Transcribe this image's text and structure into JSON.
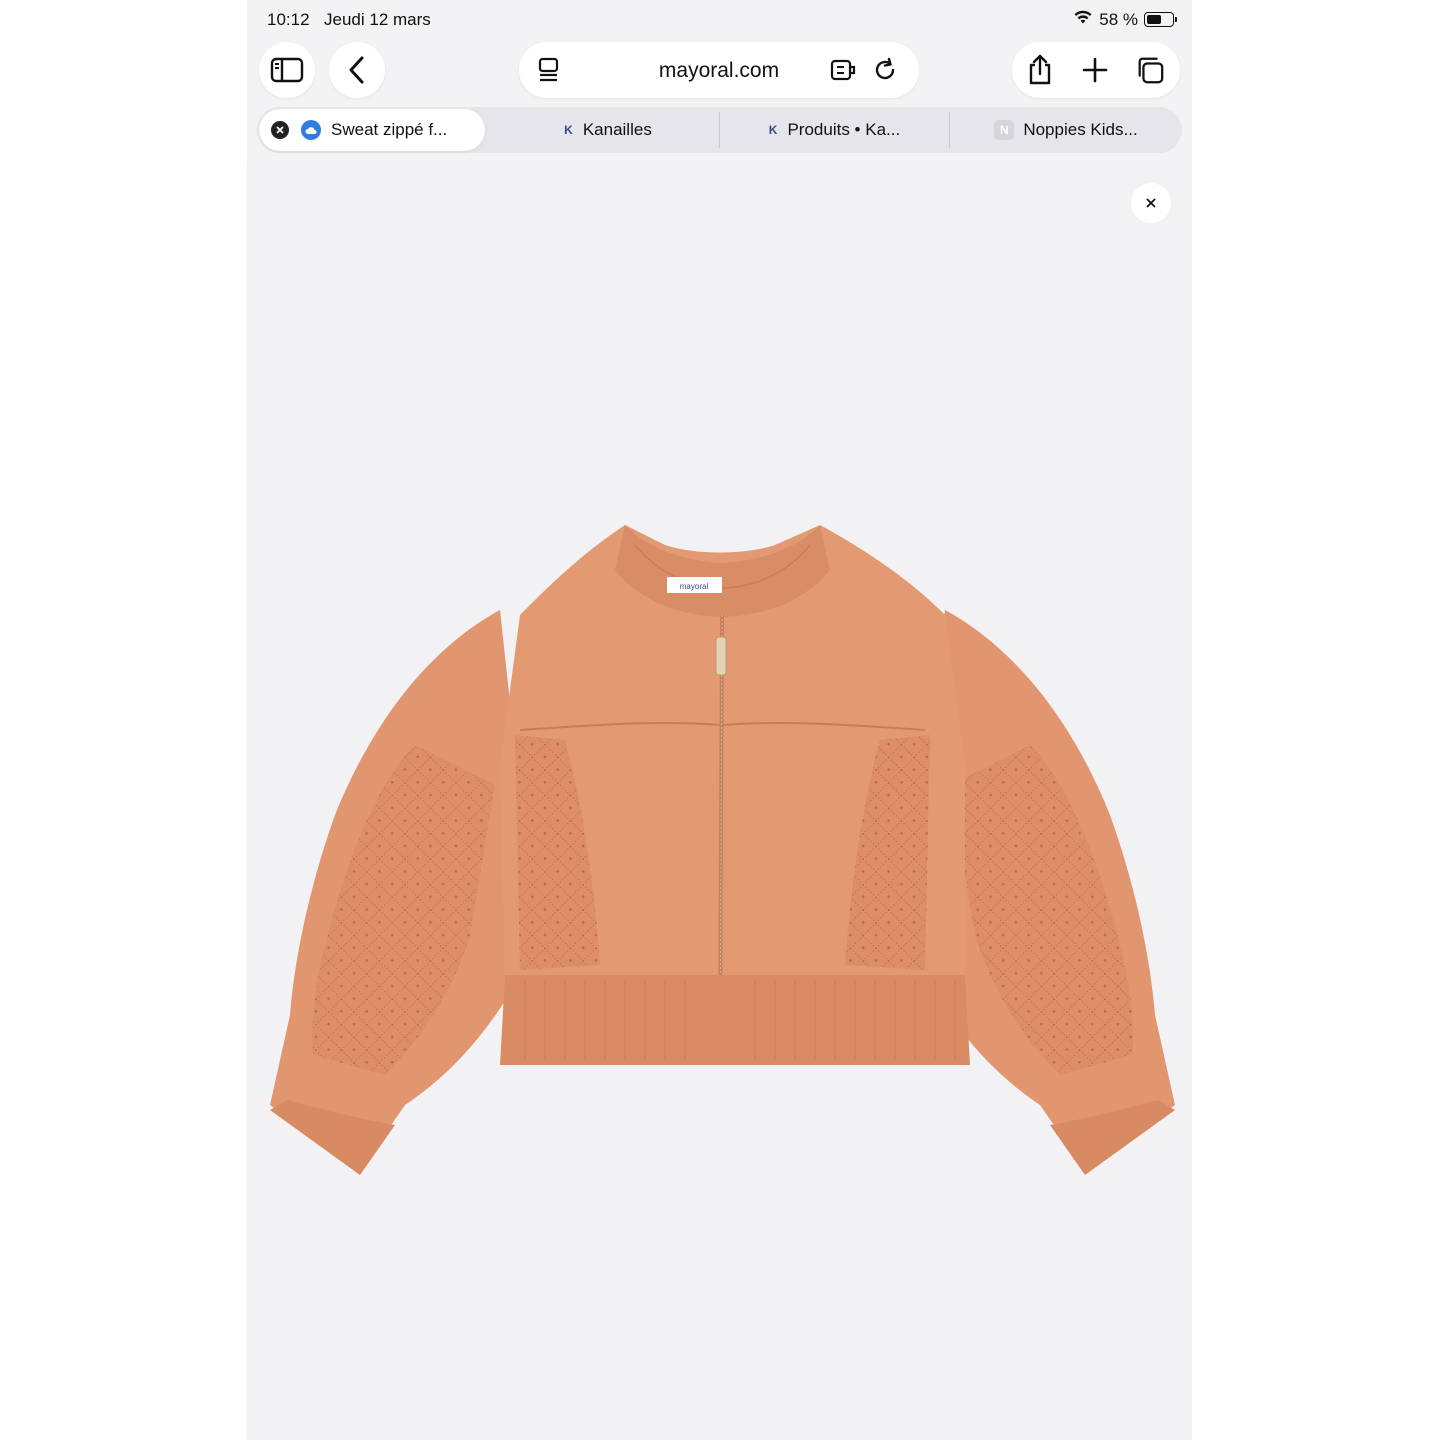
{
  "status_bar": {
    "time": "10:12",
    "date": "Jeudi 12 mars",
    "battery": "58 %",
    "battery_level": 0.58
  },
  "toolbar": {
    "url": "mayoral.com"
  },
  "tabs": [
    {
      "label": "Sweat zippé f...",
      "active": true
    },
    {
      "label": "Kanailles",
      "favicon": "K"
    },
    {
      "label": "Produits • Ka...",
      "favicon": "K"
    },
    {
      "label": "Noppies Kids...",
      "favicon": "N"
    }
  ],
  "product": {
    "brand_label": "mayoral",
    "color": "#e0946d",
    "icon": "zip-jacket-image"
  },
  "colors": {
    "background": "#f3f3f5",
    "content_bg": "#f2f2f4",
    "accent": "#2f7de1"
  }
}
